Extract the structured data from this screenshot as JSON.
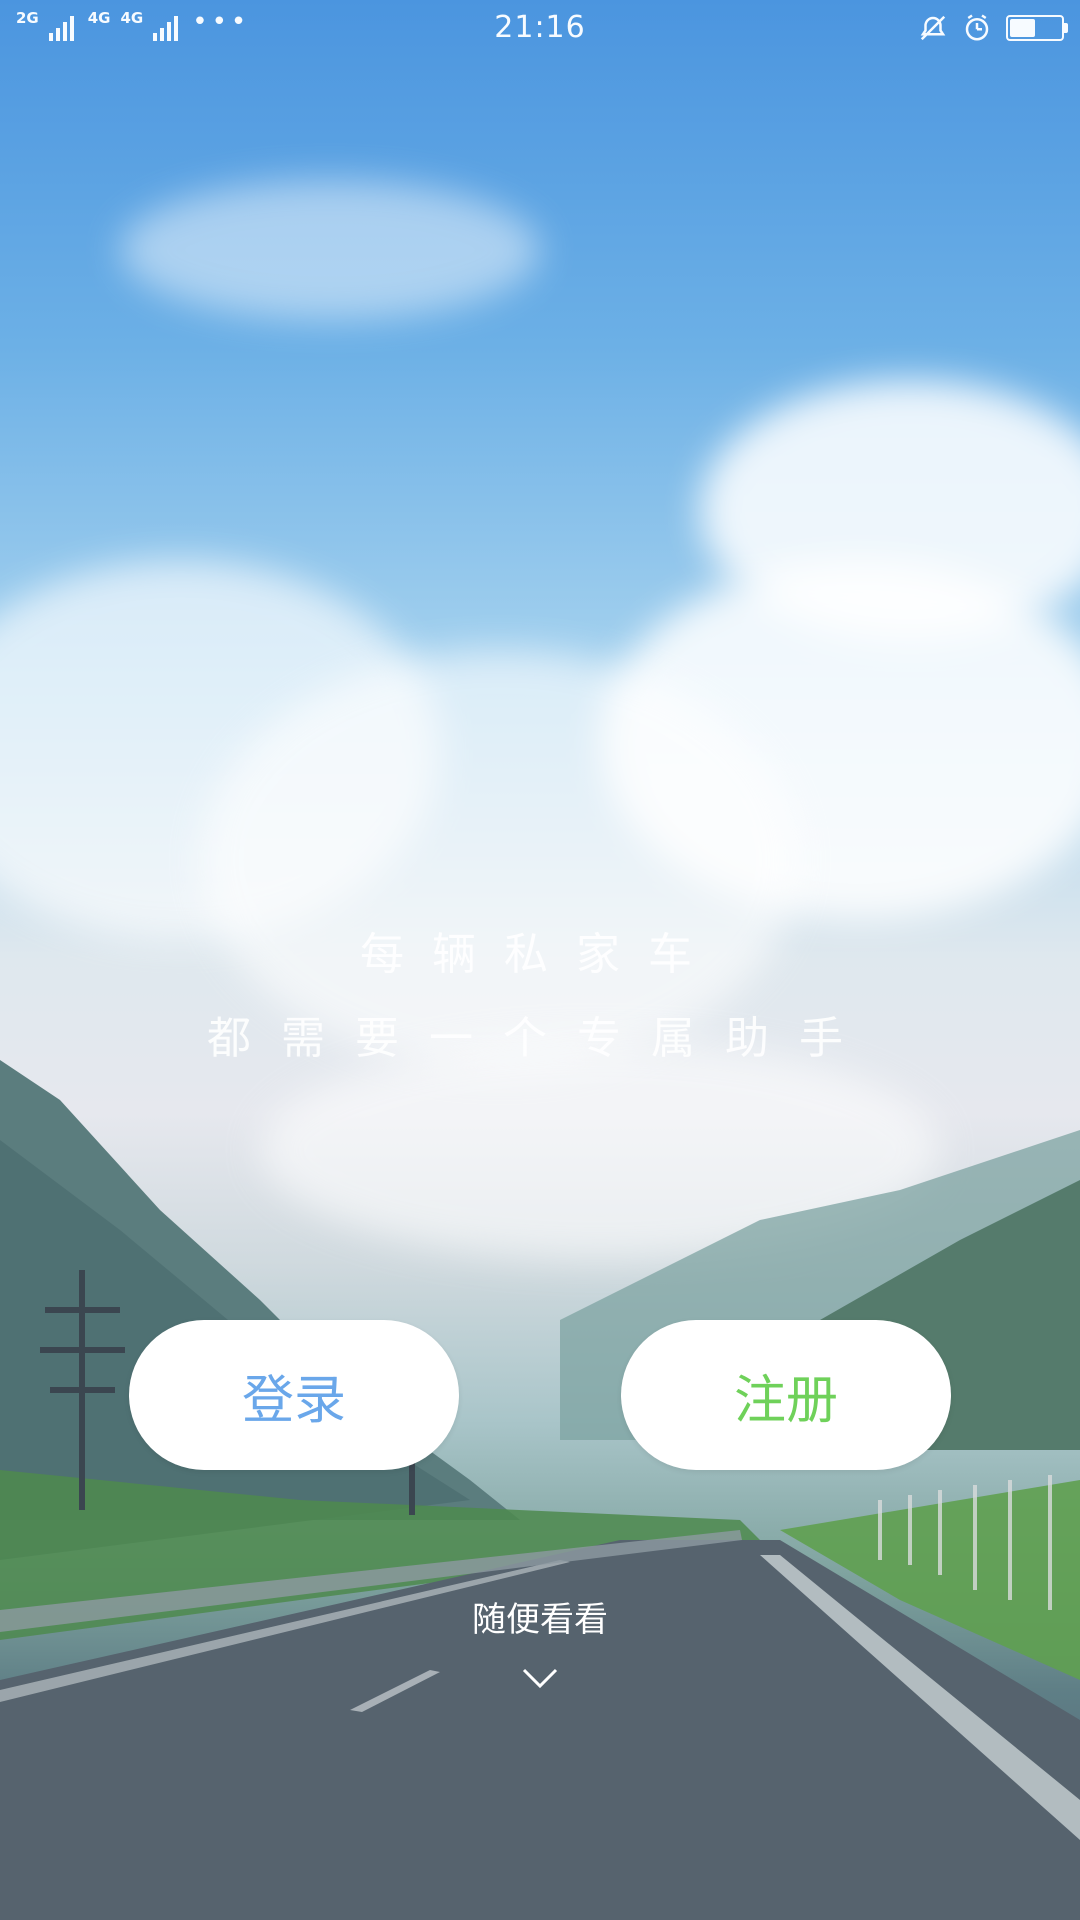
{
  "status_bar": {
    "signal_left_label": "2G",
    "signal_right_label": "4G",
    "signal_right_label2": "4G",
    "dots": "•••",
    "time": "21:16",
    "battery_level": 0.5
  },
  "slogan": {
    "line1": "每辆私家车",
    "line2": "都需要一个专属助手"
  },
  "buttons": {
    "login": "登录",
    "register": "注册"
  },
  "browse": {
    "label": "随便看看",
    "icon": "chevron-down-icon"
  },
  "colors": {
    "login_text": "#6aa7ea",
    "register_text": "#6fd15a"
  }
}
